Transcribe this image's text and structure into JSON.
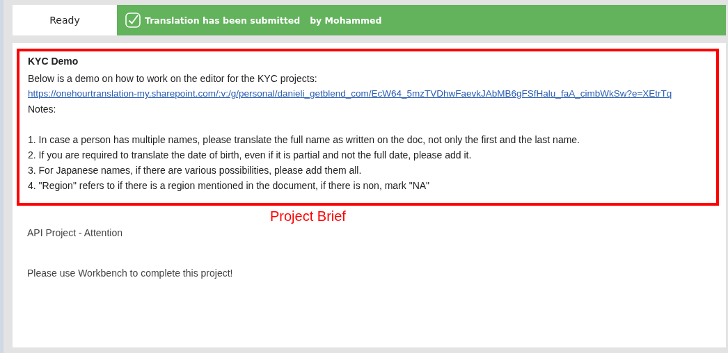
{
  "status": "Ready",
  "banner": {
    "message": "Translation has been submitted",
    "user": "by Mohammed"
  },
  "brief": {
    "title": "KYC Demo",
    "intro": "Below is a demo on how to work on the editor for the KYC projects:",
    "link": "https://onehourtranslation-my.sharepoint.com/:v:/g/personal/danieli_getblend_com/EcW64_5mzTVDhwFaevkJAbMB6gFSfHalu_faA_cimbWkSw?e=XEtrTq",
    "notes_label": "Notes:",
    "notes": [
      "1. In case a person has multiple names, please translate the full name as written on the doc, not only the first and the last name.",
      "2. If you are required to translate the date of birth, even if it is partial and not the full date, please add it.",
      "3. For Japanese names, if there are various possibilities, please add them all.",
      "4. \"Region\" refers to if there is a region mentioned in the document, if there is non, mark \"NA\""
    ]
  },
  "annotation": {
    "label": "Project Brief"
  },
  "project": {
    "heading": "API Project - Attention",
    "instruction": "Please use Workbench to complete this project!"
  }
}
